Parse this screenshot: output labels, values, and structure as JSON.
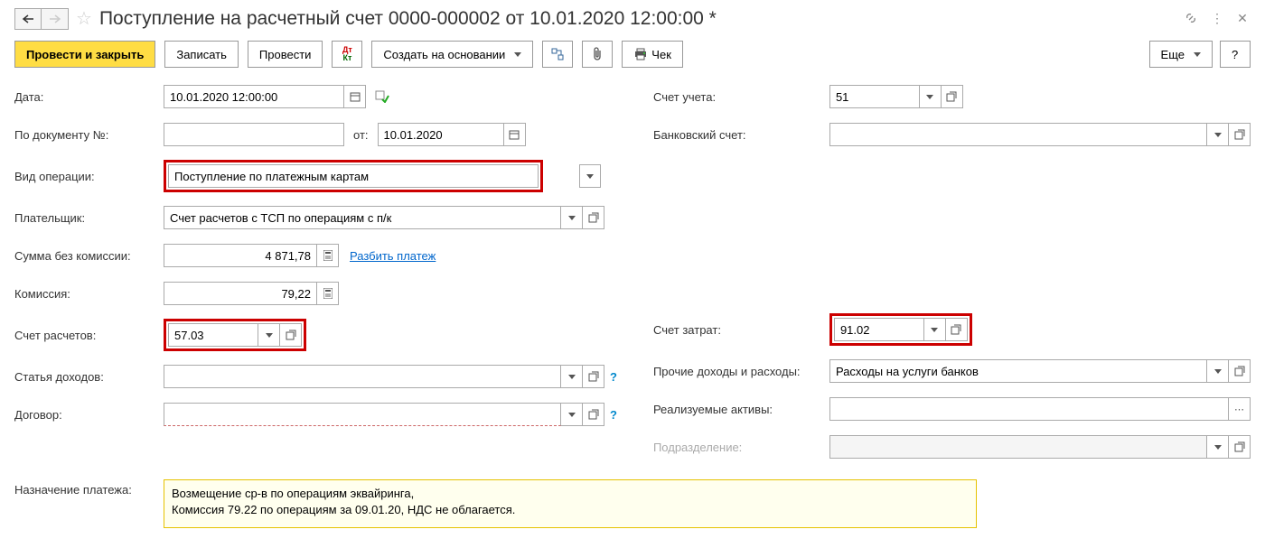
{
  "header": {
    "title": "Поступление на расчетный счет 0000-000002 от 10.01.2020 12:00:00 *"
  },
  "toolbar": {
    "post_close": "Провести и закрыть",
    "write": "Записать",
    "post": "Провести",
    "create_based": "Создать на основании",
    "cheque": "Чек",
    "more": "Еще",
    "help": "?"
  },
  "labels": {
    "date": "Дата:",
    "by_doc_no": "По документу №:",
    "from": "от:",
    "op_type": "Вид операции:",
    "payer": "Плательщик:",
    "sum_no_comm": "Сумма без комиссии:",
    "commission": "Комиссия:",
    "settle_account": "Счет расчетов:",
    "income_item": "Статья доходов:",
    "contract": "Договор:",
    "account": "Счет учета:",
    "bank_account": "Банковский счет:",
    "cost_account": "Счет затрат:",
    "other_income": "Прочие доходы и расходы:",
    "realizable": "Реализуемые активы:",
    "subdivision": "Подразделение:",
    "purpose": "Назначение платежа:",
    "split_payment": "Разбить платеж"
  },
  "values": {
    "date": "10.01.2020 12:00:00",
    "doc_no": "",
    "doc_date": "10.01.2020",
    "op_type": "Поступление по платежным картам",
    "payer": "Счет расчетов с ТСП по операциям с п/к",
    "sum_no_comm": "4 871,78",
    "commission": "79,22",
    "settle_account": "57.03",
    "income_item": "",
    "contract": "",
    "account": "51",
    "bank_account": "",
    "cost_account": "91.02",
    "other_income": "Расходы на услуги банков",
    "realizable": "",
    "subdivision": "",
    "purpose": "Возмещение ср-в по операциям эквайринга,\nКомиссия 79.22 по операциям за 09.01.20, НДС не облагается."
  }
}
